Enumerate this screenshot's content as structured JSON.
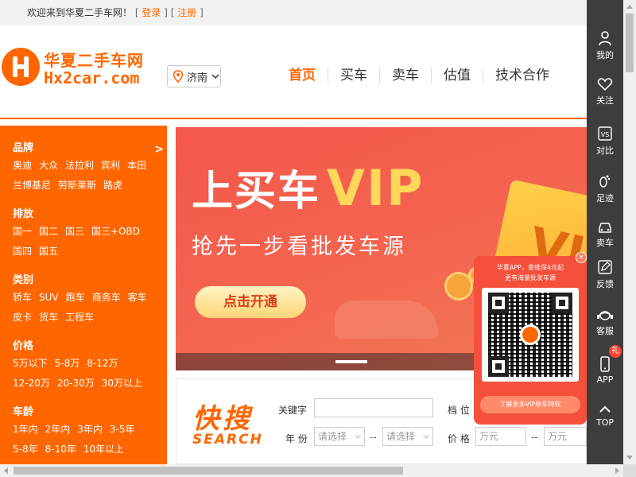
{
  "topbar": {
    "welcome": "欢迎来到华夏二手车网！",
    "bracket_open": "[",
    "bracket_close": "]",
    "login": "登录",
    "register": "注册"
  },
  "header": {
    "logo_cn": "华夏二手车网",
    "logo_en": "Hx2car.com",
    "city": "济南",
    "nav": [
      "首页",
      "买车",
      "卖车",
      "估值",
      "技术合作"
    ],
    "nav_active": "首页"
  },
  "categories": [
    {
      "title": "品牌",
      "rows": [
        [
          "奥迪",
          "大众",
          "法拉利",
          "宾利",
          "本田"
        ],
        [
          "兰博基尼",
          "劳斯莱斯",
          "路虎"
        ]
      ]
    },
    {
      "title": "排放",
      "rows": [
        [
          "国一",
          "国二",
          "国三",
          "国三+OBD"
        ],
        [
          "国四",
          "国五"
        ]
      ]
    },
    {
      "title": "类别",
      "rows": [
        [
          "轿车",
          "SUV",
          "跑车",
          "商务车",
          "客车"
        ],
        [
          "皮卡",
          "货车",
          "工程车"
        ]
      ]
    },
    {
      "title": "价格",
      "rows": [
        [
          "5万以下",
          "5-8万",
          "8-12万"
        ],
        [
          "12-20万",
          "20-30万",
          "30万以上"
        ]
      ]
    },
    {
      "title": "车龄",
      "rows": [
        [
          "1年内",
          "2年内",
          "3年内",
          "3-5年"
        ],
        [
          "5-8年",
          "8-10年",
          "10年以上"
        ]
      ]
    }
  ],
  "category_arrow": ">",
  "banner": {
    "line1": "上买车",
    "line1_vip": "VIP",
    "line2": "抢先一步看批发车源",
    "cta": "点击开通",
    "card_text": "VI"
  },
  "quick_search": {
    "title_cn": "快搜",
    "title_en": "SEARCH",
    "keyword_label": "关键字",
    "keyword_value": "",
    "gear_label": "档 位",
    "year_label": "年 份",
    "year_from": "请选择",
    "year_to": "请选择",
    "dash": "--",
    "price_label": "价 格",
    "price_from_placeholder": "万元",
    "price_to_placeholder": "万元"
  },
  "toolbar": [
    {
      "label": "我的",
      "icon": "user-icon"
    },
    {
      "label": "关注",
      "icon": "heart-icon"
    },
    {
      "label": "对比",
      "icon": "vs-icon"
    },
    {
      "label": "足迹",
      "icon": "footprint-icon"
    },
    {
      "label": "卖车",
      "icon": "car-icon"
    },
    {
      "label": "反馈",
      "icon": "edit-icon"
    },
    {
      "label": "客服",
      "icon": "headset-icon"
    },
    {
      "label": "APP",
      "icon": "phone-icon"
    },
    {
      "label": "TOP",
      "icon": "chevron-up-icon"
    }
  ],
  "toolbar_badge": "礼",
  "qr_popup": {
    "line1": "华夏APP，查维保4元起",
    "line2": "更有海量批发车源",
    "footer": "了解更多VIP收车特权",
    "close": "×"
  }
}
